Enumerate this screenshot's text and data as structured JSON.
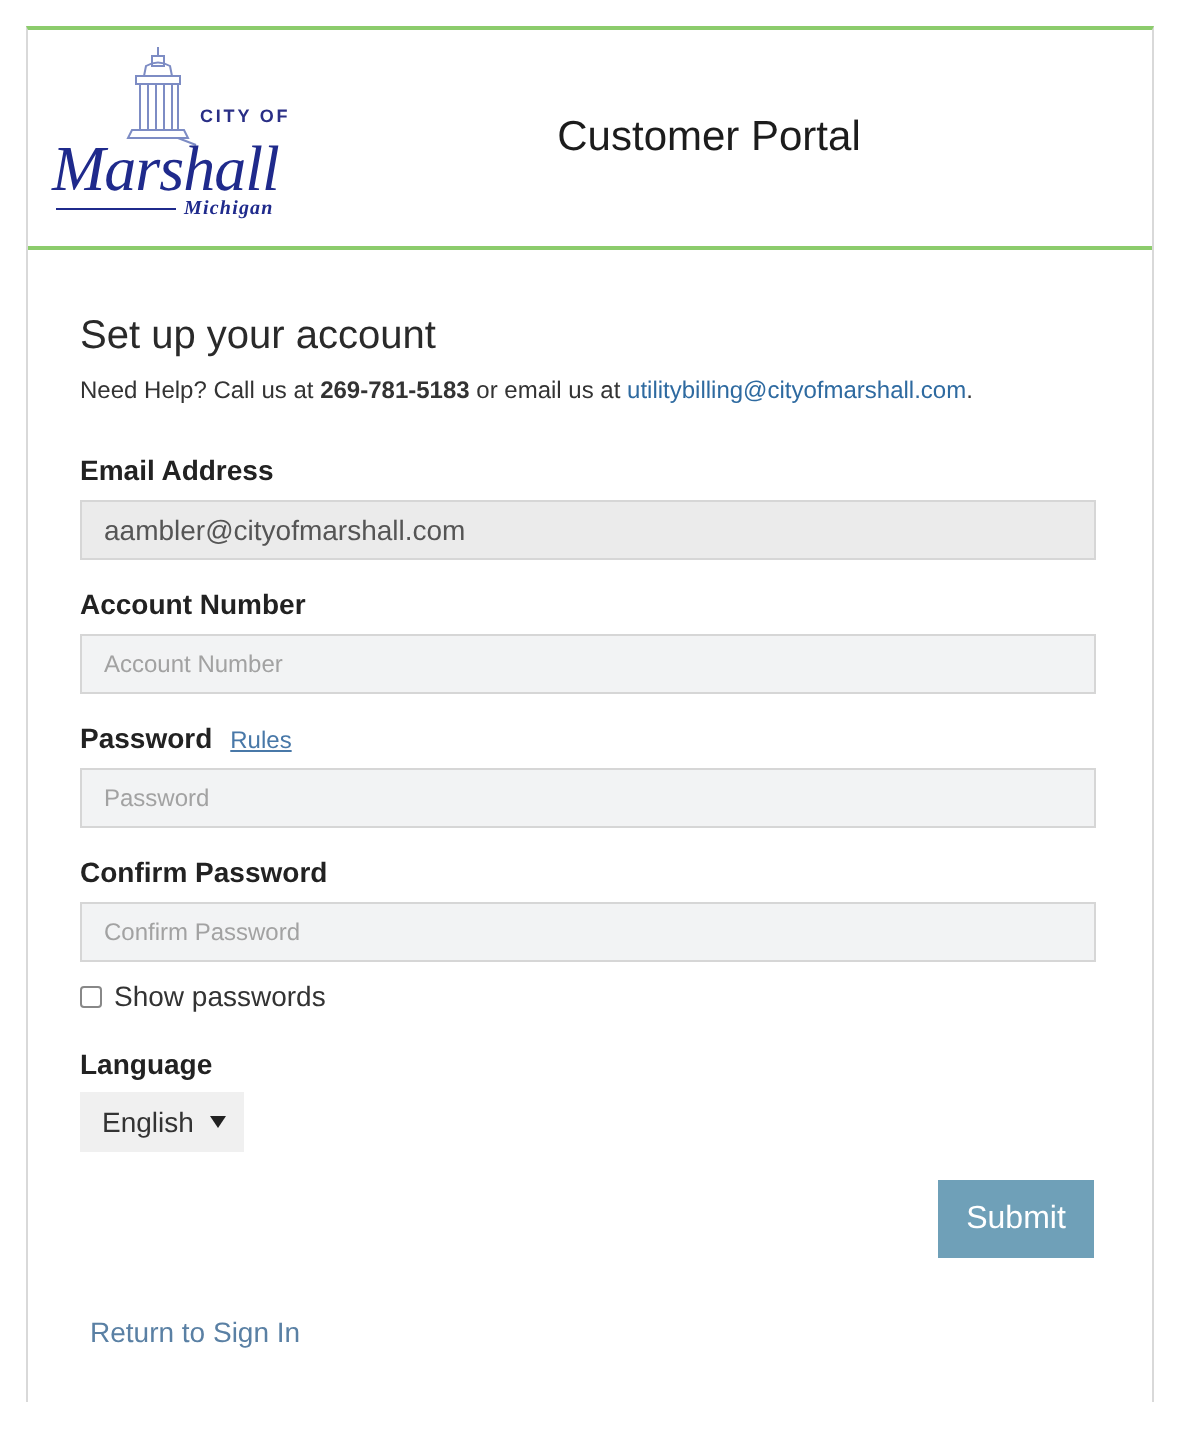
{
  "header": {
    "logo": {
      "top_line": "CITY OF",
      "name": "Marshall",
      "sub_line": "Michigan"
    },
    "title": "Customer Portal"
  },
  "form": {
    "heading": "Set up your account",
    "help": {
      "before": "Need Help? Call us at **269-781-5183** or email us at ",
      "link": "utilitybilling@cityofmarshall.com",
      "after": "."
    },
    "fields": [
      {
        "label": "Email Address",
        "value": "aambler@cityofmarshall.com",
        "disabled": true
      },
      {
        "label": "Account Number",
        "placeholder": "Account Number",
        "disabled": false
      },
      {
        "label": "Password",
        "link": "Rules",
        "placeholder": "Password",
        "disabled": false
      },
      {
        "label": "Confirm Password",
        "placeholder": "Confirm Password",
        "disabled": false
      }
    ],
    "show_passwords": {
      "label": "Show passwords",
      "checked": false
    },
    "language": {
      "label": "Language",
      "value": "English"
    },
    "submit": "Submit",
    "return_link": "Return to Sign In"
  }
}
